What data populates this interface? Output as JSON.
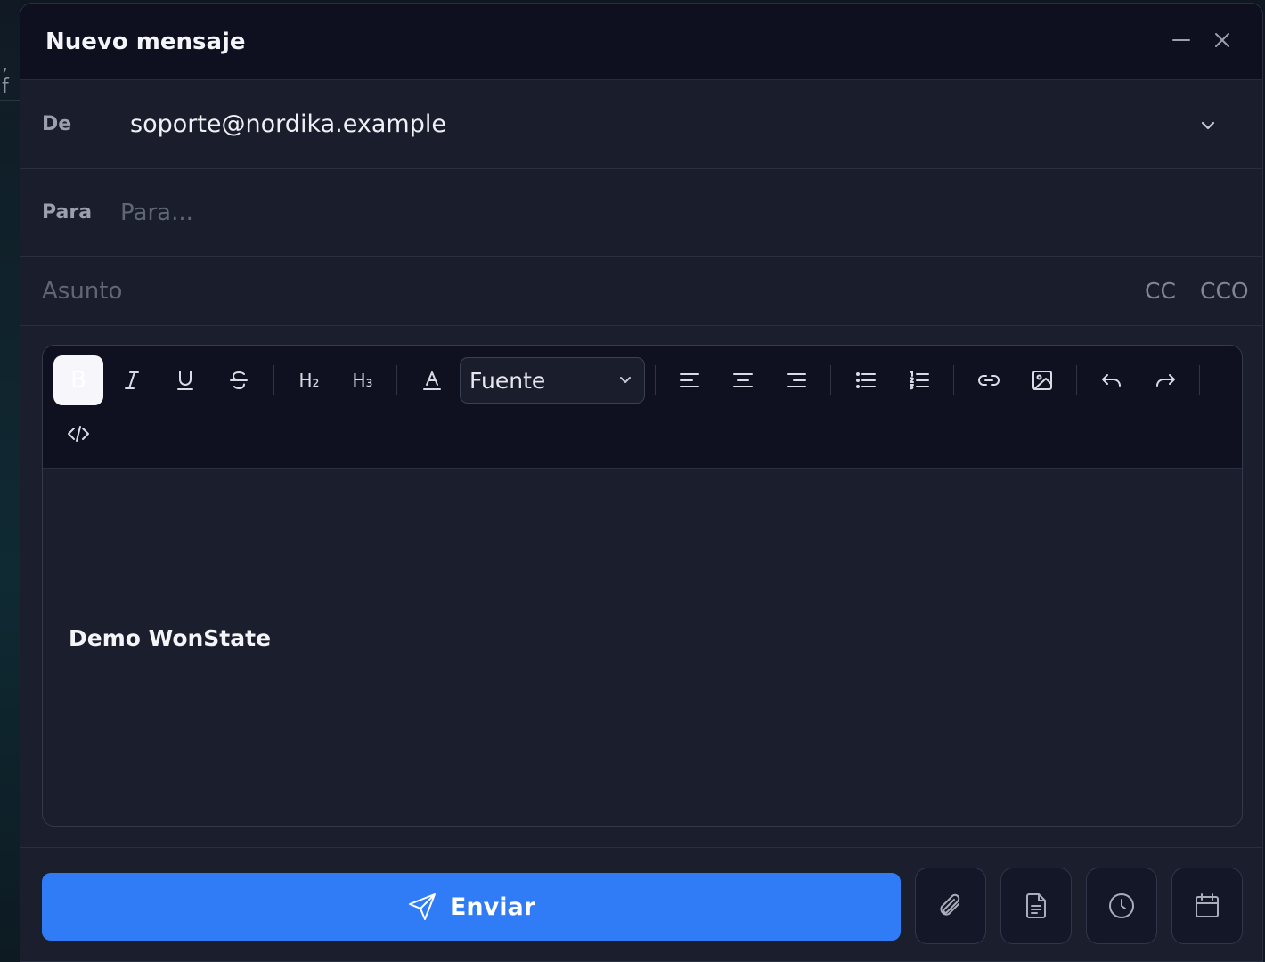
{
  "backdrop": {
    "fragment": ", f"
  },
  "window": {
    "title": "Nuevo mensaje"
  },
  "from": {
    "label": "De",
    "value": "soporte@nordika.example"
  },
  "to": {
    "label": "Para",
    "placeholder": "Para..."
  },
  "subject": {
    "placeholder": "Asunto",
    "cc_label": "CC",
    "cco_label": "CCO"
  },
  "toolbar": {
    "bold": "B",
    "h2": "H₂",
    "h3": "H₃",
    "font_select": "Fuente"
  },
  "editor": {
    "body": "Demo WonState"
  },
  "footer": {
    "send_label": "Enviar"
  },
  "colors": {
    "accent": "#2f7cf6",
    "background": "#1b1e2d",
    "header": "#0e1020"
  }
}
